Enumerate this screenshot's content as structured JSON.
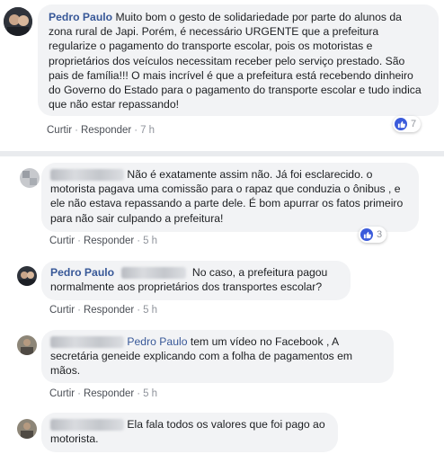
{
  "comments": [
    {
      "author": "Pedro Paulo",
      "text": "Muito bom o gesto de solidariedade por parte do alunos da zona rural de Japi. Porém, é necessário URGENTE que a prefeitura regularize o pagamento do transporte escolar, pois os motoristas e proprietários dos veículos necessitam receber pelo serviço prestado. São pais de família!!! O mais incrível é que a prefeitura está recebendo dinheiro do Governo do Estado para o pagamento do transporte escolar e tudo indica que não estar repassando!",
      "like_label": "Curtir",
      "reply_label": "Responder",
      "time": "7 h",
      "reactions": "7"
    },
    {
      "text": "Não é exatamente assim não. Já foi esclarecido. o motorista pagava uma comissão para o rapaz que conduzia o ônibus , e ele não estava repassando a parte dele. É bom apurrar os fatos primeiro para não sair culpando a prefeitura!",
      "like_label": "Curtir",
      "reply_label": "Responder",
      "time": "5 h",
      "reactions": "3"
    },
    {
      "author": "Pedro Paulo",
      "text": "No caso, a prefeitura pagou normalmente aos proprietários dos transportes escolar?",
      "like_label": "Curtir",
      "reply_label": "Responder",
      "time": "5 h"
    },
    {
      "mention": "Pedro Paulo",
      "text": "tem um vídeo no Facebook , A secretária geneide explicando com a folha de pagamentos em mãos.",
      "like_label": "Curtir",
      "reply_label": "Responder",
      "time": "5 h"
    },
    {
      "text": "Ela fala todos os valores que foi pago ao motorista."
    }
  ]
}
